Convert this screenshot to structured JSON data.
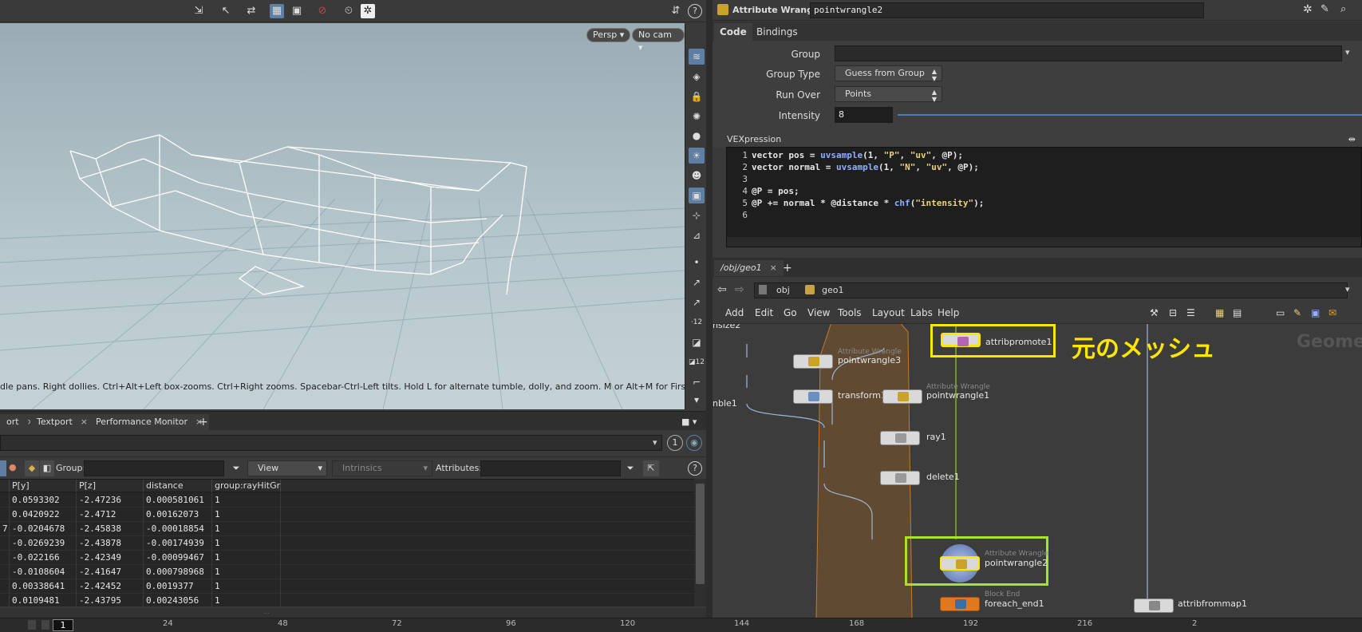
{
  "viewport": {
    "persp_label": "Persp",
    "cam_label": "No cam",
    "hint_text": "dle pans. Right dollies. Ctrl+Alt+Left box-zooms. Ctrl+Right zooms. Spacebar-Ctrl-Left tilts. Hold L for alternate tumble, dolly, and zoom. M or Alt+M for First Person"
  },
  "pane_tabs": [
    {
      "label": "ort"
    },
    {
      "label": "Textport"
    },
    {
      "label": "Performance Monitor"
    }
  ],
  "path_bar": {
    "frame_circle": "1"
  },
  "spreadsheet_toolbar": {
    "group_label": "Group:",
    "view_label": "View",
    "intrinsics_label": "Intrinsics",
    "attributes_label": "Attributes:"
  },
  "spreadsheet": {
    "columns": [
      "P[y]",
      "P[z]",
      "distance",
      "group:rayHitGr"
    ],
    "prefix_row3": "7",
    "rows": [
      [
        "0.0593302",
        "-2.47236",
        "0.000581061",
        "1"
      ],
      [
        "0.0420922",
        "-2.4712",
        "0.00162073",
        "1"
      ],
      [
        "-0.0204678",
        "-2.45838",
        "-0.00018854",
        "1"
      ],
      [
        "-0.0269239",
        "-2.43878",
        "-0.00174939",
        "1"
      ],
      [
        "-0.022166",
        "-2.42349",
        "-0.00099467",
        "1"
      ],
      [
        "-0.0108604",
        "-2.41647",
        "0.000798968",
        "1"
      ],
      [
        "0.00338641",
        "-2.42452",
        "0.0019377",
        "1"
      ],
      [
        "0.0109481",
        "-2.43795",
        "0.00243056",
        "1"
      ]
    ]
  },
  "timeline": {
    "current_frame": "1",
    "ticks": [
      "24",
      "48",
      "72",
      "96",
      "120",
      "144",
      "168",
      "192",
      "216",
      "2"
    ]
  },
  "parameters": {
    "node_type": "Attribute Wrangle",
    "node_name": "pointwrangle2",
    "tabs": [
      "Code",
      "Bindings"
    ],
    "group_label": "Group",
    "group_value": "",
    "group_type_label": "Group Type",
    "group_type_value": "Guess from Group",
    "run_over_label": "Run Over",
    "run_over_value": "Points",
    "intensity_label": "Intensity",
    "intensity_value": "8",
    "vex_label": "VEXpression",
    "code_lines": [
      {
        "n": "1",
        "text": "vector pos = uvsample(1, \"P\", \"uv\", @P);"
      },
      {
        "n": "2",
        "text": "vector normal = uvsample(1, \"N\", \"uv\", @P);"
      },
      {
        "n": "3",
        "text": ""
      },
      {
        "n": "4",
        "text": "@P = pos;"
      },
      {
        "n": "5",
        "text": "@P += normal * @distance * chf(\"intensity\");"
      },
      {
        "n": "6",
        "text": ""
      }
    ]
  },
  "network": {
    "tab_label": "/obj/geo1",
    "path_obj": "obj",
    "path_geo": "geo1",
    "menu": [
      "Add",
      "Edit",
      "Go",
      "View",
      "Tools",
      "Layout",
      "Labs",
      "Help"
    ],
    "watermark": "Geome",
    "annotation": "元のメッシュ",
    "left_labels": [
      "nsize2",
      "nble1"
    ],
    "nodes": [
      {
        "name": "pointwrangle3",
        "type": "Attribute Wrangle"
      },
      {
        "name": "attribpromote1",
        "type": ""
      },
      {
        "name": "transform1",
        "type": ""
      },
      {
        "name": "pointwrangle1",
        "type": "Attribute Wrangle"
      },
      {
        "name": "ray1",
        "type": ""
      },
      {
        "name": "delete1",
        "type": ""
      },
      {
        "name": "pointwrangle2",
        "type": "Attribute Wrangle"
      },
      {
        "name": "foreach_end1",
        "type": "Block End"
      },
      {
        "name": "attribfrommap1",
        "type": ""
      }
    ]
  },
  "colors": {
    "highlight_yellow": "#ffe600",
    "highlight_green": "#a6e22e",
    "accent_blue": "#5e7fa3"
  }
}
